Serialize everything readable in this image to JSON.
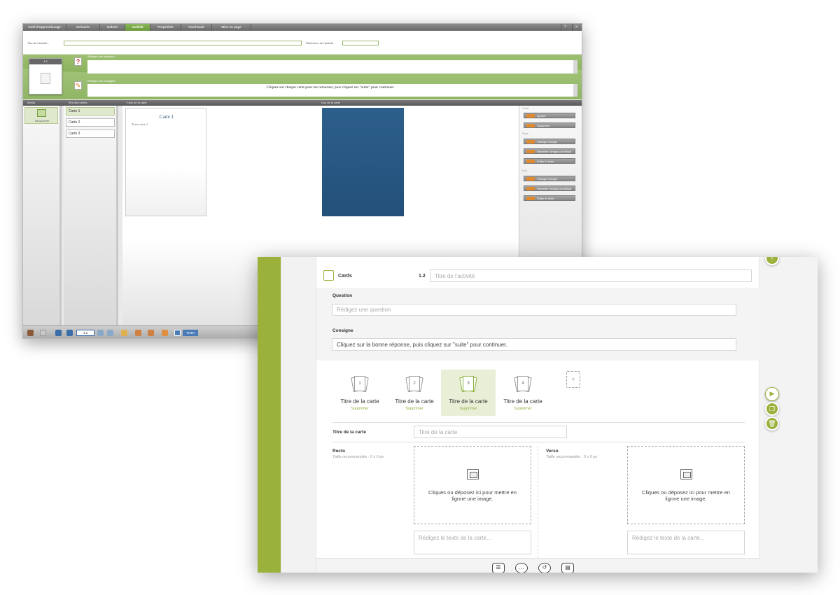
{
  "old_window": {
    "tabs": [
      "Outil d'Apprentissage",
      "Scénario",
      "Galerie",
      "Activité",
      "Propriétés",
      "Feed-back",
      "Mise en page"
    ],
    "active_tab": "Activité",
    "window_buttons": [
      "?",
      "X"
    ],
    "activity_title_label": "Titre de l'activité :",
    "activity_ref_label": "Référence de l'activité :",
    "thumb_number": "4.2",
    "question_label": "Rédigez une question",
    "instruction_label": "Rédigez une consigne",
    "instruction_text": "Cliquez sur chaque carte pour les retourner, puis cliquez sur \"suite\" pour continuer.",
    "columns": [
      "Média",
      "Titre des cartes",
      "Face de la carte",
      "Dos de la carte"
    ],
    "media_item": "Découverte",
    "card_titles": [
      "Carte 1",
      "Carte 2",
      "Carte 3"
    ],
    "front_title": "Carte 1",
    "front_text": "Texte carte 1",
    "back_color": "#2a5a85",
    "panel_sections": [
      "Carte",
      "Face",
      "Dos"
    ],
    "buttons_carte": [
      "Ajouter",
      "Supprimer"
    ],
    "buttons_face": [
      "Changer l'image",
      "Remettre l'image par défaut",
      "Editer le texte"
    ],
    "buttons_dos": [
      "Changer l'image",
      "Remettre l'image par défaut",
      "Editer le texte"
    ],
    "bottom_page": "4.2",
    "bottom_last": "Tester"
  },
  "new_window": {
    "activity_type": "Cards",
    "activity_number": "1.2",
    "title_placeholder": "Titre de l'activité",
    "question_label": "Question",
    "question_placeholder": "Rédigez une question",
    "instruction_label": "Consigne",
    "instruction_value": "Cliquez sur la bonne réponse, puis cliquez sur \"suite\" pour continuer.",
    "cards": [
      {
        "number": "1",
        "title": "Titre de la carte",
        "delete": "Supprimer"
      },
      {
        "number": "2",
        "title": "Titre de la carte",
        "delete": "Supprimer"
      },
      {
        "number": "3",
        "title": "Titre de la carte",
        "delete": "Supprimer"
      },
      {
        "number": "4",
        "title": "Titre de la carte",
        "delete": "Supprimer"
      }
    ],
    "selected_card": "3",
    "add_card_symbol": "+",
    "card_title_label": "Titre de la carte",
    "card_title_placeholder": "Titre de la carte",
    "recto_label": "Recto",
    "recto_hint": "Taille recommandée : 0 x 0 px",
    "verso_label": "Verso",
    "verso_hint": "Taille recommandée : 0 x 0 px",
    "drop_text": "Cliques ou déposez ici pour mettre en lignne une image.",
    "card_text_placeholder": "Rédigez le texte de la carte...",
    "accent_color": "#9ab23c"
  }
}
